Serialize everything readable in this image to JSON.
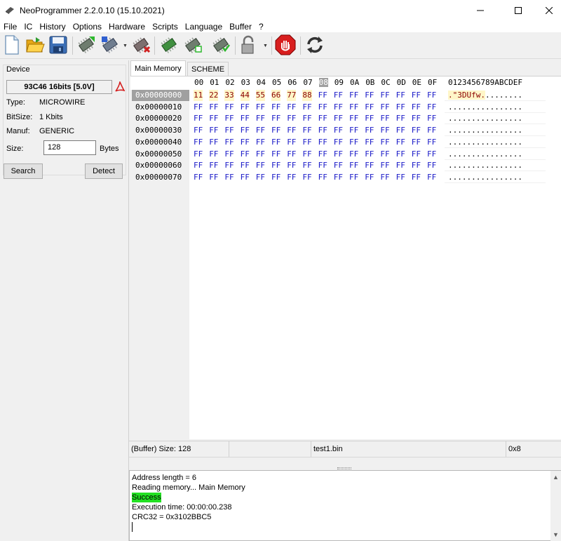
{
  "window": {
    "title": "NeoProgrammer 2.2.0.10 (15.10.2021)"
  },
  "menu": [
    "File",
    "IC",
    "History",
    "Options",
    "Hardware",
    "Scripts",
    "Language",
    "Buffer",
    "?"
  ],
  "device": {
    "group_label": "Device",
    "name": "93C46 16bits [5.0V]",
    "type_label": "Type:",
    "type_value": "MICROWIRE",
    "bitsize_label": "BitSize:",
    "bitsize_value": "1 Kbits",
    "manuf_label": "Manuf:",
    "manuf_value": "GENERIC",
    "size_label": "Size:",
    "size_value": "128",
    "bytes_label": "Bytes",
    "search_button": "Search",
    "detect_button": "Detect"
  },
  "tabs": [
    "Main Memory",
    "SCHEME"
  ],
  "hex": {
    "columns": [
      "00",
      "01",
      "02",
      "03",
      "04",
      "05",
      "06",
      "07",
      "08",
      "09",
      "0A",
      "0B",
      "0C",
      "0D",
      "0E",
      "0F"
    ],
    "ascii_header": "0123456789ABCDEF",
    "rows": [
      {
        "addr": "0x00000000",
        "bytes": [
          "11",
          "22",
          "33",
          "44",
          "55",
          "66",
          "77",
          "88",
          "FF",
          "FF",
          "FF",
          "FF",
          "FF",
          "FF",
          "FF",
          "FF"
        ],
        "ascii_mod": ".\"3DUfw.",
        "ascii_rest": "........"
      },
      {
        "addr": "0x00000010",
        "bytes": [
          "FF",
          "FF",
          "FF",
          "FF",
          "FF",
          "FF",
          "FF",
          "FF",
          "FF",
          "FF",
          "FF",
          "FF",
          "FF",
          "FF",
          "FF",
          "FF"
        ],
        "ascii_mod": "",
        "ascii_rest": "................"
      },
      {
        "addr": "0x00000020",
        "bytes": [
          "FF",
          "FF",
          "FF",
          "FF",
          "FF",
          "FF",
          "FF",
          "FF",
          "FF",
          "FF",
          "FF",
          "FF",
          "FF",
          "FF",
          "FF",
          "FF"
        ],
        "ascii_mod": "",
        "ascii_rest": "................"
      },
      {
        "addr": "0x00000030",
        "bytes": [
          "FF",
          "FF",
          "FF",
          "FF",
          "FF",
          "FF",
          "FF",
          "FF",
          "FF",
          "FF",
          "FF",
          "FF",
          "FF",
          "FF",
          "FF",
          "FF"
        ],
        "ascii_mod": "",
        "ascii_rest": "................"
      },
      {
        "addr": "0x00000040",
        "bytes": [
          "FF",
          "FF",
          "FF",
          "FF",
          "FF",
          "FF",
          "FF",
          "FF",
          "FF",
          "FF",
          "FF",
          "FF",
          "FF",
          "FF",
          "FF",
          "FF"
        ],
        "ascii_mod": "",
        "ascii_rest": "................"
      },
      {
        "addr": "0x00000050",
        "bytes": [
          "FF",
          "FF",
          "FF",
          "FF",
          "FF",
          "FF",
          "FF",
          "FF",
          "FF",
          "FF",
          "FF",
          "FF",
          "FF",
          "FF",
          "FF",
          "FF"
        ],
        "ascii_mod": "",
        "ascii_rest": "................"
      },
      {
        "addr": "0x00000060",
        "bytes": [
          "FF",
          "FF",
          "FF",
          "FF",
          "FF",
          "FF",
          "FF",
          "FF",
          "FF",
          "FF",
          "FF",
          "FF",
          "FF",
          "FF",
          "FF",
          "FF"
        ],
        "ascii_mod": "",
        "ascii_rest": "................"
      },
      {
        "addr": "0x00000070",
        "bytes": [
          "FF",
          "FF",
          "FF",
          "FF",
          "FF",
          "FF",
          "FF",
          "FF",
          "FF",
          "FF",
          "FF",
          "FF",
          "FF",
          "FF",
          "FF",
          "FF"
        ],
        "ascii_mod": "",
        "ascii_rest": "................"
      }
    ]
  },
  "status": {
    "buffer_size": "(Buffer) Size: 128",
    "file": "test1.bin",
    "offset": "0x8"
  },
  "log": [
    "Address length = 6",
    "Reading memory... Main Memory",
    "Success",
    "Execution time: 00:00:00.238",
    "CRC32 = 0x3102BBC5"
  ],
  "colors": {
    "success": "#22e022",
    "hex_byte": "#1a1ac8",
    "modified_bg": "#fff6c8"
  },
  "icons": [
    "new-file-icon",
    "open-folder-icon",
    "save-icon",
    "read-chip-icon",
    "write-chip-icon",
    "erase-chip-icon",
    "verify-chip-icon",
    "blank-check-icon",
    "auto-chip-icon",
    "lock-icon",
    "stop-icon",
    "refresh-icon"
  ]
}
